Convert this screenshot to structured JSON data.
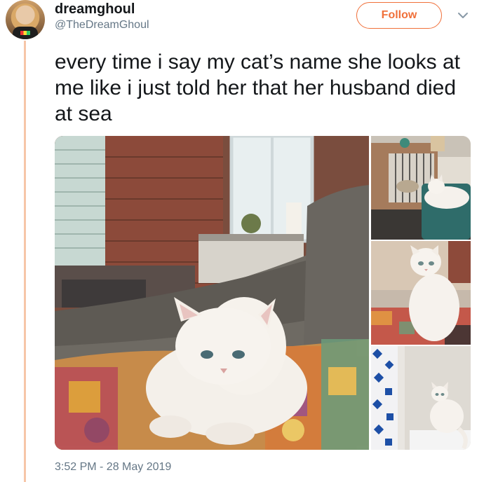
{
  "user": {
    "display_name": "dreamghoul",
    "handle": "@TheDreamGhoul"
  },
  "actions": {
    "follow_label": "Follow",
    "more_icon": "chevron-down-icon"
  },
  "tweet": {
    "text": "every time i say my cat’s name she looks at me like i just told her that her husband died at sea",
    "timestamp": "3:52 PM - 28 May 2019"
  },
  "colors": {
    "accent": "#f0703a",
    "thread_line": "#f6c6a8",
    "secondary_text": "#657786",
    "primary_text": "#14171a"
  }
}
